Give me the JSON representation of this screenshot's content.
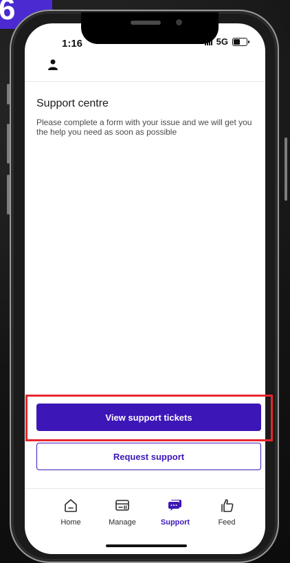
{
  "step_badge": "6",
  "status_bar": {
    "time": "1:16",
    "network": "5G"
  },
  "page": {
    "title": "Support centre",
    "description": "Please complete a form with your issue and we will get you the help you need as soon as possible"
  },
  "buttons": {
    "view_tickets": "View support tickets",
    "request_support": "Request support"
  },
  "tab_bar": {
    "tabs": [
      {
        "label": "Home",
        "icon": "home-icon",
        "active": false
      },
      {
        "label": "Manage",
        "icon": "card-icon",
        "active": false
      },
      {
        "label": "Support",
        "icon": "chat-bubbles-icon",
        "active": true
      },
      {
        "label": "Feed",
        "icon": "thumbs-up-icon",
        "active": false
      }
    ]
  },
  "colors": {
    "accent": "#3d16b8",
    "highlight": "#e6262e",
    "badge": "#4b2ad1"
  }
}
